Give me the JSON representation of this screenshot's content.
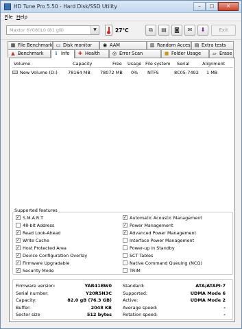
{
  "window": {
    "title": "HD Tune Pro 5.50 - Hard Disk/SSD Utility",
    "controls": [
      "–",
      "□",
      "✕"
    ]
  },
  "menu": [
    {
      "label_u": "F",
      "label_rest": "ile"
    },
    {
      "label_u": "H",
      "label_rest": "elp"
    }
  ],
  "toolbar": {
    "drive": "Maxtor 6Y080L0 (81 gB)",
    "temperature": "27°C",
    "exit_label": "Exit"
  },
  "tabs_top": [
    {
      "label": "File Benchmark",
      "icon": "file-benchmark-icon"
    },
    {
      "label": "Disk monitor",
      "icon": "disk-monitor-icon"
    },
    {
      "label": "AAM",
      "icon": "aam-icon"
    },
    {
      "label": "Random Access",
      "icon": "random-access-icon"
    },
    {
      "label": "Extra tests",
      "icon": "extra-tests-icon"
    }
  ],
  "tabs_bottom": [
    {
      "label": "Benchmark",
      "icon": "benchmark-icon"
    },
    {
      "label": "Info",
      "icon": "info-icon"
    },
    {
      "label": "Health",
      "icon": "health-icon"
    },
    {
      "label": "Error Scan",
      "icon": "error-scan-icon"
    },
    {
      "label": "Folder Usage",
      "icon": "folder-usage-icon"
    },
    {
      "label": "Erase",
      "icon": "erase-icon"
    }
  ],
  "volumes": {
    "headers": [
      "Volume",
      "Capacity",
      "Free",
      "Usage",
      "File system",
      "Serial",
      "Alignment"
    ],
    "rows": [
      {
        "volume": "New Volume (D:)",
        "capacity": "78164 MB",
        "free": "78072 MB",
        "usage": "0%",
        "file_system": "NTFS",
        "serial": "8C05-7492",
        "alignment": "1 MB"
      }
    ]
  },
  "features": {
    "title": "Supported features",
    "left": [
      {
        "label": "S.M.A.R.T",
        "checked": true
      },
      {
        "label": "48-bit Address",
        "checked": false
      },
      {
        "label": "Read Look-Ahead",
        "checked": true
      },
      {
        "label": "Write Cache",
        "checked": true
      },
      {
        "label": "Host Protected Area",
        "checked": true
      },
      {
        "label": "Device Configuration Overlay",
        "checked": true
      },
      {
        "label": "Firmware Upgradable",
        "checked": true
      },
      {
        "label": "Security Mode",
        "checked": true
      }
    ],
    "right": [
      {
        "label": "Automatic Acoustic Management",
        "checked": true
      },
      {
        "label": "Power Management",
        "checked": true
      },
      {
        "label": "Advanced Power Management",
        "checked": true
      },
      {
        "label": "Interface Power Management",
        "checked": false
      },
      {
        "label": "Power-up in Standby",
        "checked": false
      },
      {
        "label": "SCT Tables",
        "checked": false
      },
      {
        "label": "Native Command Queuing (NCQ)",
        "checked": false
      },
      {
        "label": "TRIM",
        "checked": false
      }
    ]
  },
  "info": {
    "left": [
      {
        "key": "Firmware version:",
        "value": "YAR41BW0"
      },
      {
        "key": "Serial number:",
        "value": "Y20R5N3C"
      },
      {
        "key": "Capacity:",
        "value": "82.0 gB (76.3 GB)"
      },
      {
        "key": "Buffer:",
        "value": "2048 KB"
      },
      {
        "key": "Sector size",
        "value": "512 bytes"
      }
    ],
    "right": [
      {
        "key": "Standard:",
        "value": "ATA/ATAPI-7"
      },
      {
        "key": "Supported:",
        "value": "UDMA Mode 6"
      },
      {
        "key": "Active:",
        "value": "UDMA Mode 2"
      },
      {
        "key": "Average speed:",
        "value": "-"
      },
      {
        "key": "Rotation speed:",
        "value": "-"
      }
    ]
  }
}
